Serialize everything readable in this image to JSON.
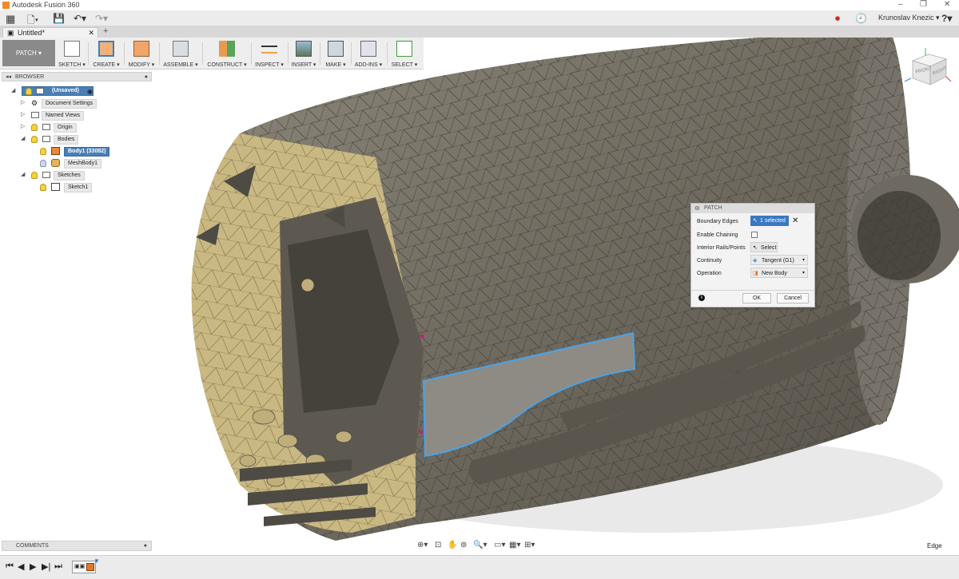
{
  "app": {
    "title": "Autodesk Fusion 360"
  },
  "document": {
    "tab_name": "Untitled*"
  },
  "user": {
    "name": "Krunoslav Knezic ▾"
  },
  "toolbar": {
    "workspace": "PATCH ▾",
    "groups": [
      "SKETCH ▾",
      "CREATE ▾",
      "MODIFY ▾",
      "ASSEMBLE ▾",
      "CONSTRUCT ▾",
      "INSPECT ▾",
      "INSERT ▾",
      "MAKE ▾",
      "ADD-INS ▾",
      "SELECT ▾"
    ]
  },
  "browser": {
    "header": "BROWSER",
    "items": [
      {
        "label": "(Unsaved)"
      },
      {
        "label": "Document Settings"
      },
      {
        "label": "Named Views"
      },
      {
        "label": "Origin"
      },
      {
        "label": "Bodies"
      },
      {
        "label": "Body1 (33082)"
      },
      {
        "label": "MeshBody1"
      },
      {
        "label": "Sketches"
      },
      {
        "label": "Sketch1"
      }
    ]
  },
  "dialog": {
    "title": "PATCH",
    "boundary_edges_label": "Boundary Edges",
    "boundary_edges_value": "1 selected",
    "enable_chaining_label": "Enable Chaining",
    "enable_chaining_checked": false,
    "interior_rails_label": "Interior Rails/Points",
    "interior_rails_value": "Select",
    "continuity_label": "Continuity",
    "continuity_value": "Tangent (G1)",
    "operation_label": "Operation",
    "operation_value": "New Body",
    "ok_label": "OK",
    "cancel_label": "Cancel"
  },
  "comments": {
    "label": "COMMENTS"
  },
  "status": {
    "selection_filter": "Edge"
  },
  "viewcube": {
    "top": "TOP",
    "front": "FRONT",
    "right": "RIGHT"
  },
  "colors": {
    "accent": "#4a7fb5",
    "selection_edge": "#4aa3e8",
    "mesh_dark": "#6b665a",
    "mesh_interior": "#c9b882",
    "workspace_button": "#8a8a8a"
  }
}
